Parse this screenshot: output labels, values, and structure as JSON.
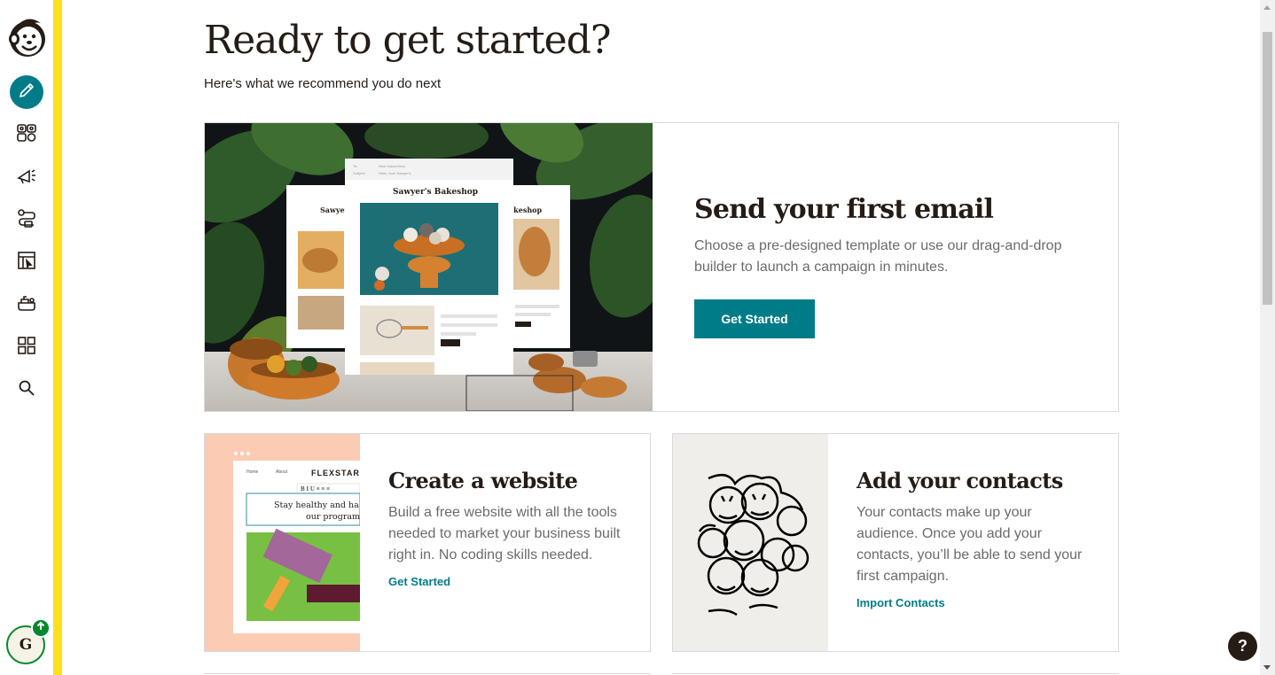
{
  "nav": {
    "logo_icon": "freddie-monkey-logo",
    "items": [
      {
        "icon": "pencil-icon",
        "name": "create",
        "active": true
      },
      {
        "icon": "audience-icon",
        "name": "audience"
      },
      {
        "icon": "megaphone-icon",
        "name": "campaigns"
      },
      {
        "icon": "automations-icon",
        "name": "automations"
      },
      {
        "icon": "website-icon",
        "name": "website"
      },
      {
        "icon": "content-icon",
        "name": "content-studio"
      },
      {
        "icon": "integrations-grid-icon",
        "name": "integrations"
      },
      {
        "icon": "search-icon",
        "name": "search"
      }
    ],
    "avatar_initial": "G",
    "accent_color": "#007c89",
    "brand_yellow": "#ffe01b"
  },
  "header": {
    "title": "Ready to get started?",
    "subtitle": "Here's what we recommend you do next"
  },
  "hero": {
    "title": "Send your first email",
    "description": "Choose a pre-designed template or use our drag-and-drop builder to launch a campaign in minutes.",
    "button_label": "Get Started",
    "image": {
      "front_card_title": "Sawyer's Bakeshop",
      "left_card_title": "Sawyer'",
      "right_card_title": "akeshop",
      "header_line_1": "To:",
      "header_line_1_value": "New Subscribers",
      "header_line_2": "Subject:",
      "header_line_2_value": "Hello, from Sawyer's"
    }
  },
  "cards": [
    {
      "id": "website",
      "title": "Create a website",
      "description": "Build a free website with all the tools needed to market your business built right in. No coding skills needed.",
      "link_label": "Get Started",
      "image": {
        "brand": "FLEXSTART",
        "nav_home": "Home",
        "nav_about": "About",
        "headline": "Stay healthy and ha our program",
        "headline_line1": "Stay healthy and ha",
        "headline_line2": "our program"
      }
    },
    {
      "id": "contacts",
      "title": "Add your contacts",
      "description": "Your contacts make up your audience. Once you add your contacts, you’ll be able to send your first campaign.",
      "link_label": "Import Contacts"
    }
  ],
  "help": {
    "label": "?"
  }
}
